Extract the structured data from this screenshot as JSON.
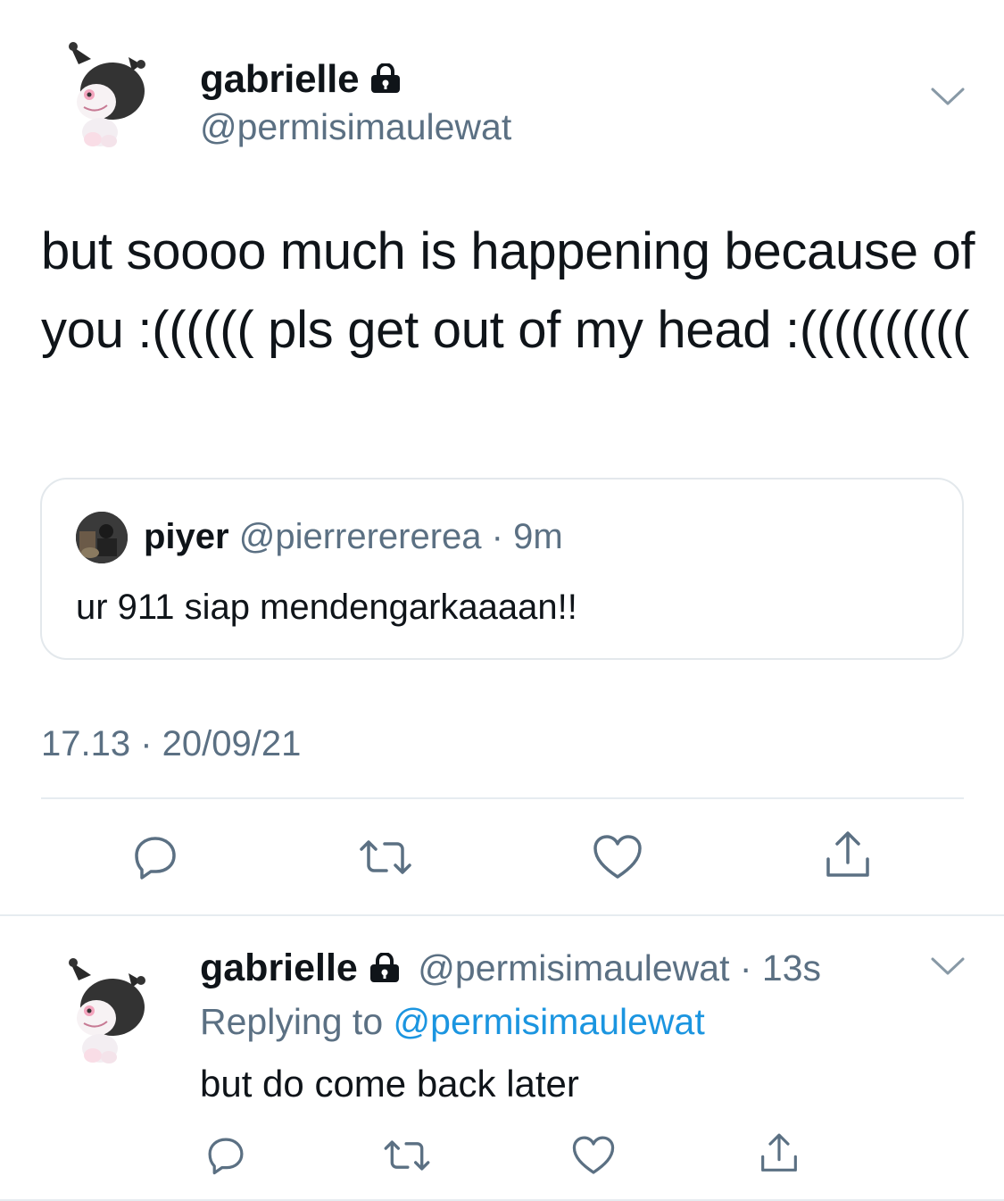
{
  "main_tweet": {
    "display_name": "gabrielle",
    "handle": "@permisimaulewat",
    "avatar_icon": "kuromi-avatar",
    "text": "but soooo much is happening because of you :(((((( pls get out of my head :((((((((((",
    "timestamp": "17.13 · 20/09/21"
  },
  "quoted_tweet": {
    "display_name": "piyer",
    "meta": "@pierrerererea · 9m",
    "text": "ur 911 siap mendengarkaaaan!!"
  },
  "reply_tweet": {
    "display_name": "gabrielle",
    "meta": "@permisimaulewat · 13s",
    "replying_prefix": "Replying to ",
    "replying_mention": "@permisimaulewat",
    "text": "but do come back later"
  },
  "colors": {
    "text": "#0f1419",
    "secondary": "#5b7083",
    "link": "#1b95e0",
    "border": "#e6ecf0"
  }
}
